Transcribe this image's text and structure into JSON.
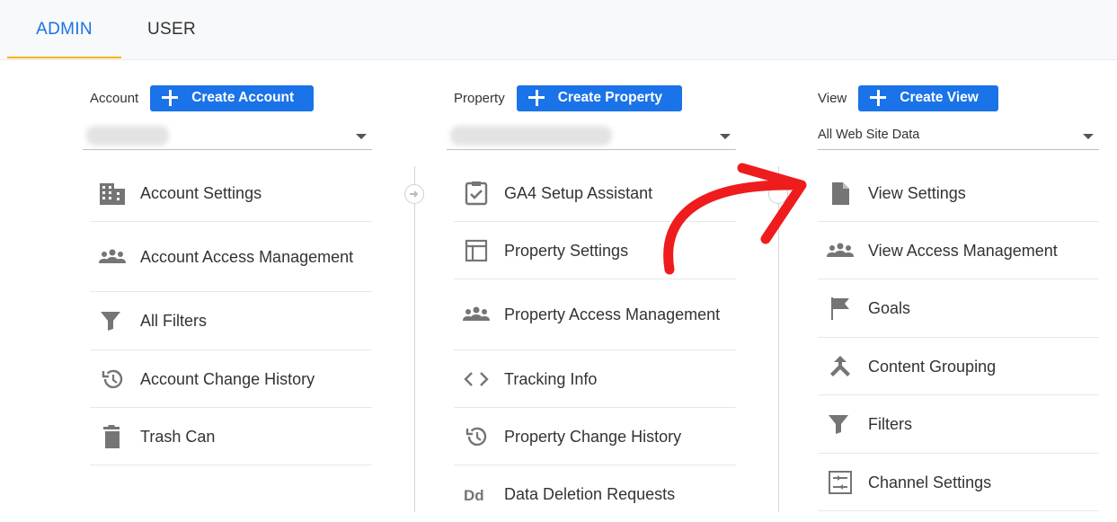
{
  "tabs": [
    {
      "label": "ADMIN",
      "active": true
    },
    {
      "label": "USER",
      "active": false
    }
  ],
  "columns": {
    "account": {
      "label": "Account",
      "create_label": "Create Account",
      "selector_value": "",
      "items": [
        {
          "label": "Account Settings",
          "icon": "building-icon"
        },
        {
          "label": "Account Access Management",
          "icon": "people-icon"
        },
        {
          "label": "All Filters",
          "icon": "filter-icon"
        },
        {
          "label": "Account Change History",
          "icon": "history-icon"
        },
        {
          "label": "Trash Can",
          "icon": "trash-icon"
        }
      ]
    },
    "property": {
      "label": "Property",
      "create_label": "Create Property",
      "selector_value": "",
      "items": [
        {
          "label": "GA4 Setup Assistant",
          "icon": "clipboard-check-icon"
        },
        {
          "label": "Property Settings",
          "icon": "layout-icon"
        },
        {
          "label": "Property Access Management",
          "icon": "people-icon"
        },
        {
          "label": "Tracking Info",
          "icon": "code-icon"
        },
        {
          "label": "Property Change History",
          "icon": "history-icon"
        },
        {
          "label": "Data Deletion Requests",
          "icon": "dd-icon"
        }
      ]
    },
    "view": {
      "label": "View",
      "create_label": "Create View",
      "selector_value": "All Web Site Data",
      "items": [
        {
          "label": "View Settings",
          "icon": "document-icon"
        },
        {
          "label": "View Access Management",
          "icon": "people-icon"
        },
        {
          "label": "Goals",
          "icon": "flag-icon"
        },
        {
          "label": "Content Grouping",
          "icon": "merge-icon"
        },
        {
          "label": "Filters",
          "icon": "filter-icon"
        },
        {
          "label": "Channel Settings",
          "icon": "sliders-icon"
        }
      ]
    }
  },
  "colors": {
    "accent": "#1a73e8",
    "tab_underline": "#f4b400",
    "annotation": "#ee1c1c",
    "icon": "#757575"
  }
}
